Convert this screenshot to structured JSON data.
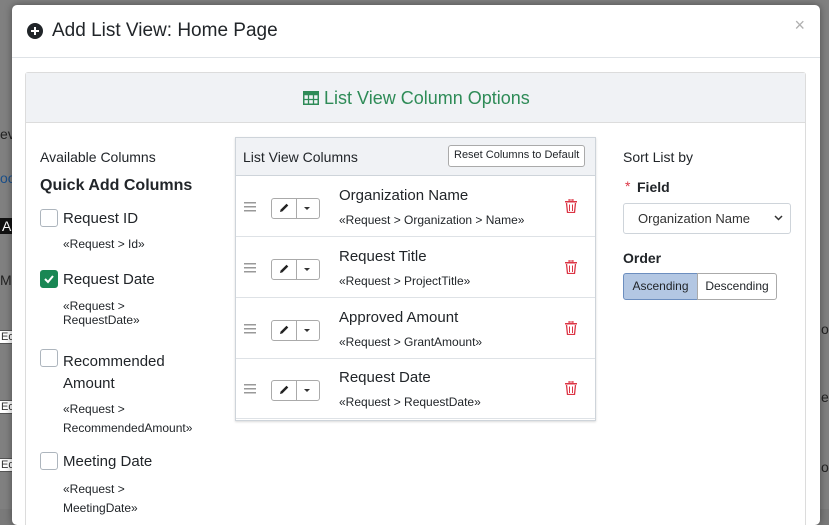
{
  "modal": {
    "title": "Add List View: Home Page",
    "close_label": "×"
  },
  "panel": {
    "title": "List View Column Options"
  },
  "available": {
    "title": "Available Columns",
    "quick_title": "Quick Add Columns",
    "items": [
      {
        "label": "Request ID",
        "path": "«Request > Id»",
        "checked": false
      },
      {
        "label": "Request Date",
        "path": "«Request > RequestDate»",
        "checked": true
      },
      {
        "label": "Recommended Amount",
        "path": "«Request > RecommendedAmount»",
        "checked": false
      },
      {
        "label": "Meeting Date",
        "path": "«Request > MeetingDate»",
        "checked": false
      }
    ]
  },
  "list_view": {
    "title": "List View Columns",
    "reset_label": "Reset Columns to Default",
    "rows": [
      {
        "name": "Organization Name",
        "path": "«Request > Organization > Name»"
      },
      {
        "name": "Request Title",
        "path": "«Request > ProjectTitle»"
      },
      {
        "name": "Approved Amount",
        "path": "«Request > GrantAmount»"
      },
      {
        "name": "Request Date",
        "path": "«Request > RequestDate»"
      }
    ]
  },
  "sort": {
    "title": "Sort List by",
    "required_mark": "*",
    "field_label": "Field",
    "field_value": "Organization Name",
    "order_label": "Order",
    "ascending_label": "Ascending",
    "descending_label": "Descending",
    "selected_order": "Ascending"
  },
  "background": {
    "fragments": [
      "ev",
      "oo",
      "Ad",
      "Ma",
      "Ed",
      "Ed",
      "Ed",
      "o",
      "es",
      "or"
    ]
  },
  "colors": {
    "accent_green": "#2e8b57",
    "checkbox_green": "#198754",
    "trash_red": "#dc3545",
    "active_segment": "#b3c7e3"
  }
}
